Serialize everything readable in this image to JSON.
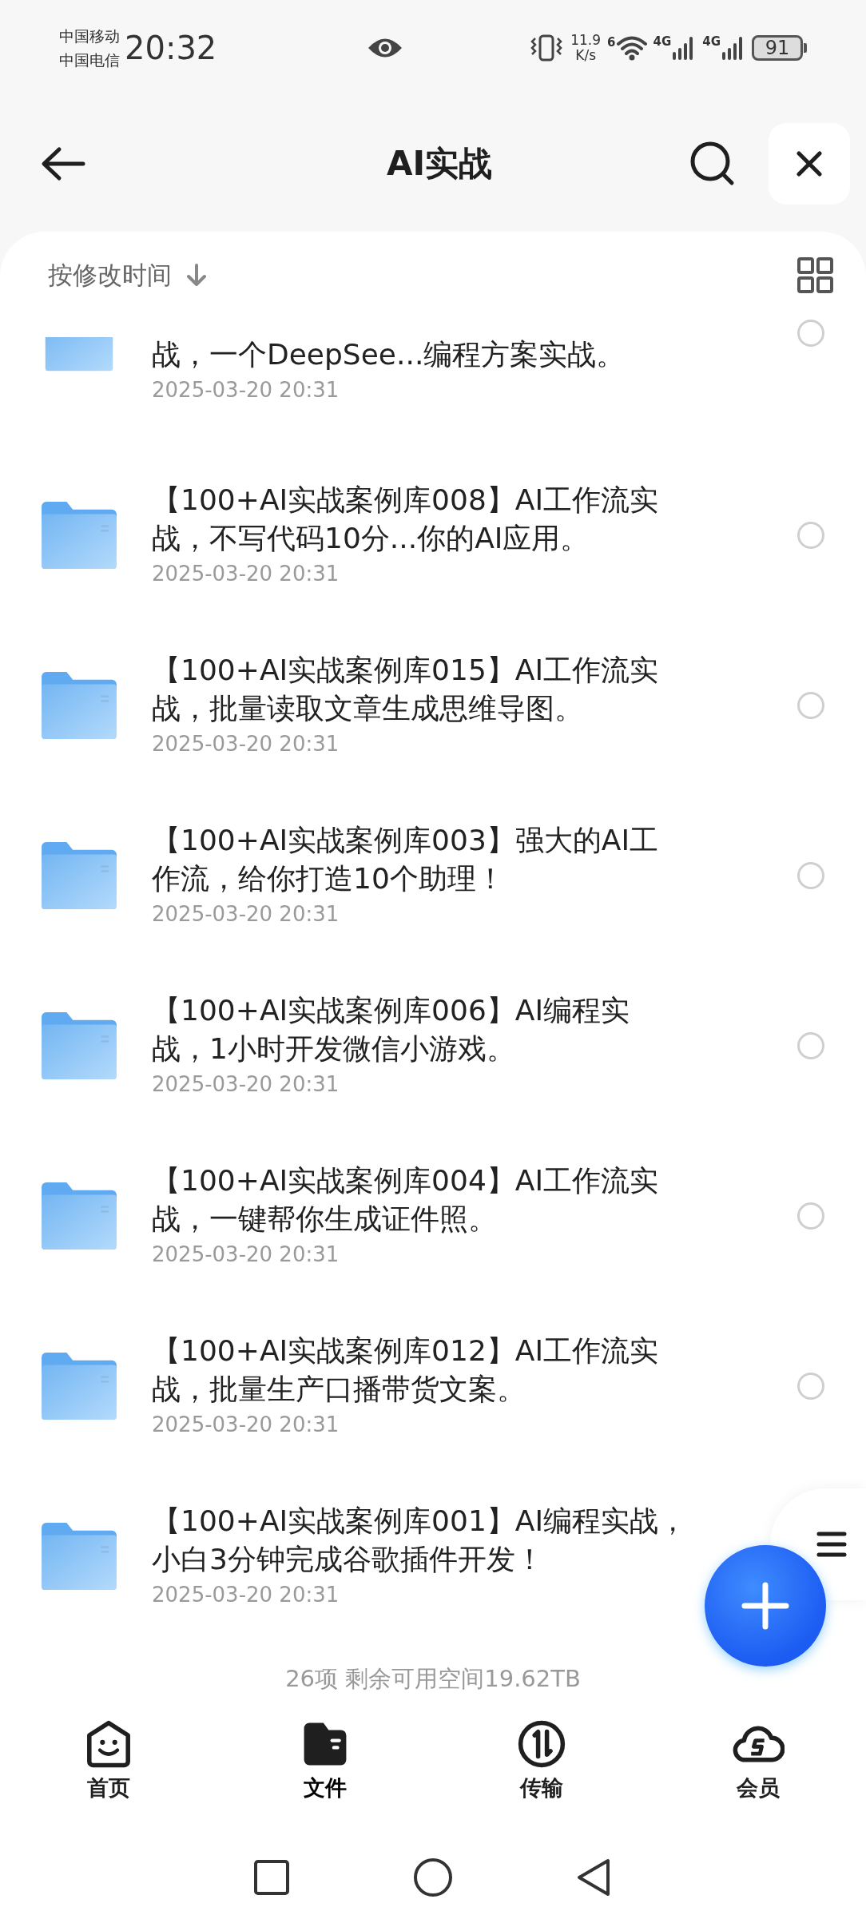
{
  "status_bar": {
    "carriers": [
      "中国移动",
      "中国电信"
    ],
    "time": "20:32",
    "net_speed_value": "11.9",
    "net_speed_unit": "K/s",
    "wifi_label": "6",
    "signal_labels": [
      "4G",
      "4G"
    ],
    "battery": "91"
  },
  "header": {
    "title": "AI实战"
  },
  "sort": {
    "label": "按修改时间"
  },
  "files": [
    {
      "kind": "partial",
      "title": "战，一个DeepSee...编程方案实战。",
      "date": "2025-03-20 20:31",
      "selected": false
    },
    {
      "kind": "full",
      "title": "【100+AI实战案例库008】AI工作流实战，不写代码10分...你的AI应用。",
      "date": "2025-03-20 20:31",
      "selected": false
    },
    {
      "kind": "full",
      "title": "【100+AI实战案例库015】AI工作流实战，批量读取文章生成思维导图。",
      "date": "2025-03-20 20:31",
      "selected": false
    },
    {
      "kind": "full",
      "title": "【100+AI实战案例库003】强大的AI工作流，给你打造10个助理！",
      "date": "2025-03-20 20:31",
      "selected": false
    },
    {
      "kind": "full",
      "title": "【100+AI实战案例库006】AI编程实战，1小时开发微信小游戏。",
      "date": "2025-03-20 20:31",
      "selected": false
    },
    {
      "kind": "full",
      "title": "【100+AI实战案例库004】AI工作流实战，一键帮你生成证件照。",
      "date": "2025-03-20 20:31",
      "selected": false
    },
    {
      "kind": "full",
      "title": "【100+AI实战案例库012】AI工作流实战，批量生产口播带货文案。",
      "date": "2025-03-20 20:31",
      "selected": false
    },
    {
      "kind": "full",
      "title": "【100+AI实战案例库001】AI编程实战，小白3分钟完成谷歌插件开发！",
      "date": "2025-03-20 20:31"
    }
  ],
  "summary": "26项 剩余可用空间19.62TB",
  "nav": [
    {
      "kind": "home",
      "label": "首页",
      "selected": false
    },
    {
      "kind": "files",
      "label": "文件",
      "selected": true
    },
    {
      "kind": "transfer",
      "label": "传输",
      "selected": false
    },
    {
      "kind": "member",
      "label": "会员",
      "selected": false
    }
  ]
}
